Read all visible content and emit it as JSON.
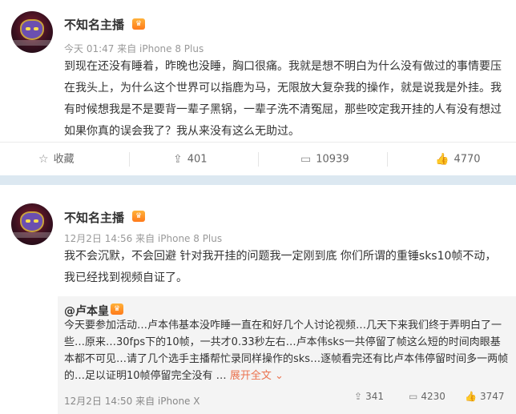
{
  "post1": {
    "author": "不知名主播",
    "vip_badge": "♛",
    "meta": "今天 01:47 来自 iPhone 8 Plus",
    "text": "到现在还没有睡着，昨晚也没睡，胸口很痛。我就是想不明白为什么没有做过的事情要压在我头上，为什么这个世界可以指鹿为马，无限放大复杂我的操作，就是说我是外挂。我有时候想我是不是要背一辈子黑锅，一辈子洗不清冤屈，那些咬定我开挂的人有没有想过如果你真的误会我了？我从来没有这么无助过。",
    "actions": {
      "favorite": "收藏",
      "repost_count": "401",
      "comment_count": "10939",
      "like_count": "4770"
    }
  },
  "post2": {
    "author": "不知名主播",
    "vip_badge": "♛",
    "meta": "12月2日 14:56 来自 iPhone 8 Plus",
    "text": "我不会沉默，不会回避 针对我开挂的问题我一定刚到底 你们所谓的重锤sks10帧不动，我已经找到视频自证了。",
    "repost": {
      "author": "@卢本皇",
      "text": "今天要参加活动…卢本伟基本没咋睡一直在和好几个人讨论视频…几天下来我们终于弄明白了一些…原来…30fps下的10帧，一共才0.33秒左右…卢本伟sks一共停留了帧这么短的时间肉眼基本都不可见…请了几个选手主播帮忙录同样操作的sks…逐帧看完还有比卢本伟停留时间多一两帧的…足以证明10帧停留完全没有 …",
      "expand": "展开全文 ⌄",
      "meta": "12月2日 14:50 来自 iPhone X",
      "repost_count": "341",
      "comment_count": "4230",
      "like_count": "3747"
    }
  }
}
